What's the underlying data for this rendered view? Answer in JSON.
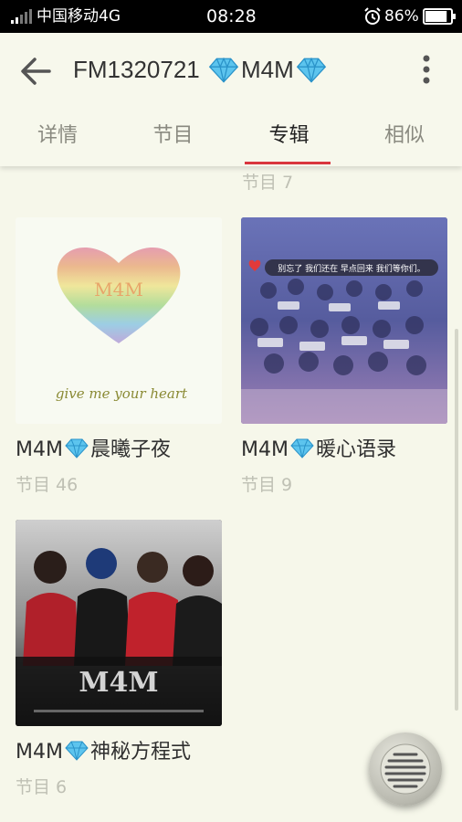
{
  "status_bar": {
    "carrier": "中国移动4G",
    "time": "08:28",
    "battery": "86%",
    "battery_level": 0.86
  },
  "header": {
    "title_prefix": "FM1320721 ",
    "title_suffix": "M4M",
    "back_icon": "arrow-left-icon",
    "more_icon": "more-vertical-icon"
  },
  "tabs": [
    {
      "label": "详情",
      "active": false
    },
    {
      "label": "节目",
      "active": false
    },
    {
      "label": "专辑",
      "active": true
    },
    {
      "label": "相似",
      "active": false
    }
  ],
  "partial_item": {
    "subtitle": "节目 7"
  },
  "albums": [
    {
      "title_prefix": "M4M",
      "title_suffix": "晨曦子夜",
      "subtitle": "节目 46",
      "cover_text": "M4M",
      "cover_caption": "give me your heart"
    },
    {
      "title_prefix": "M4M",
      "title_suffix": "暖心语录",
      "subtitle": "节目 9",
      "cover_text": "别忘了 我们还在 早点回来 我们等你们。"
    },
    {
      "title_prefix": "M4M",
      "title_suffix": "神秘方程式",
      "subtitle": "节目 6",
      "cover_text": "M4M"
    }
  ],
  "colors": {
    "accent": "#d9363e",
    "background": "#f6f7ea",
    "diamond": "#4fb8e8"
  },
  "icons": {
    "diamond": "diamond-icon",
    "player": "player-icon"
  }
}
